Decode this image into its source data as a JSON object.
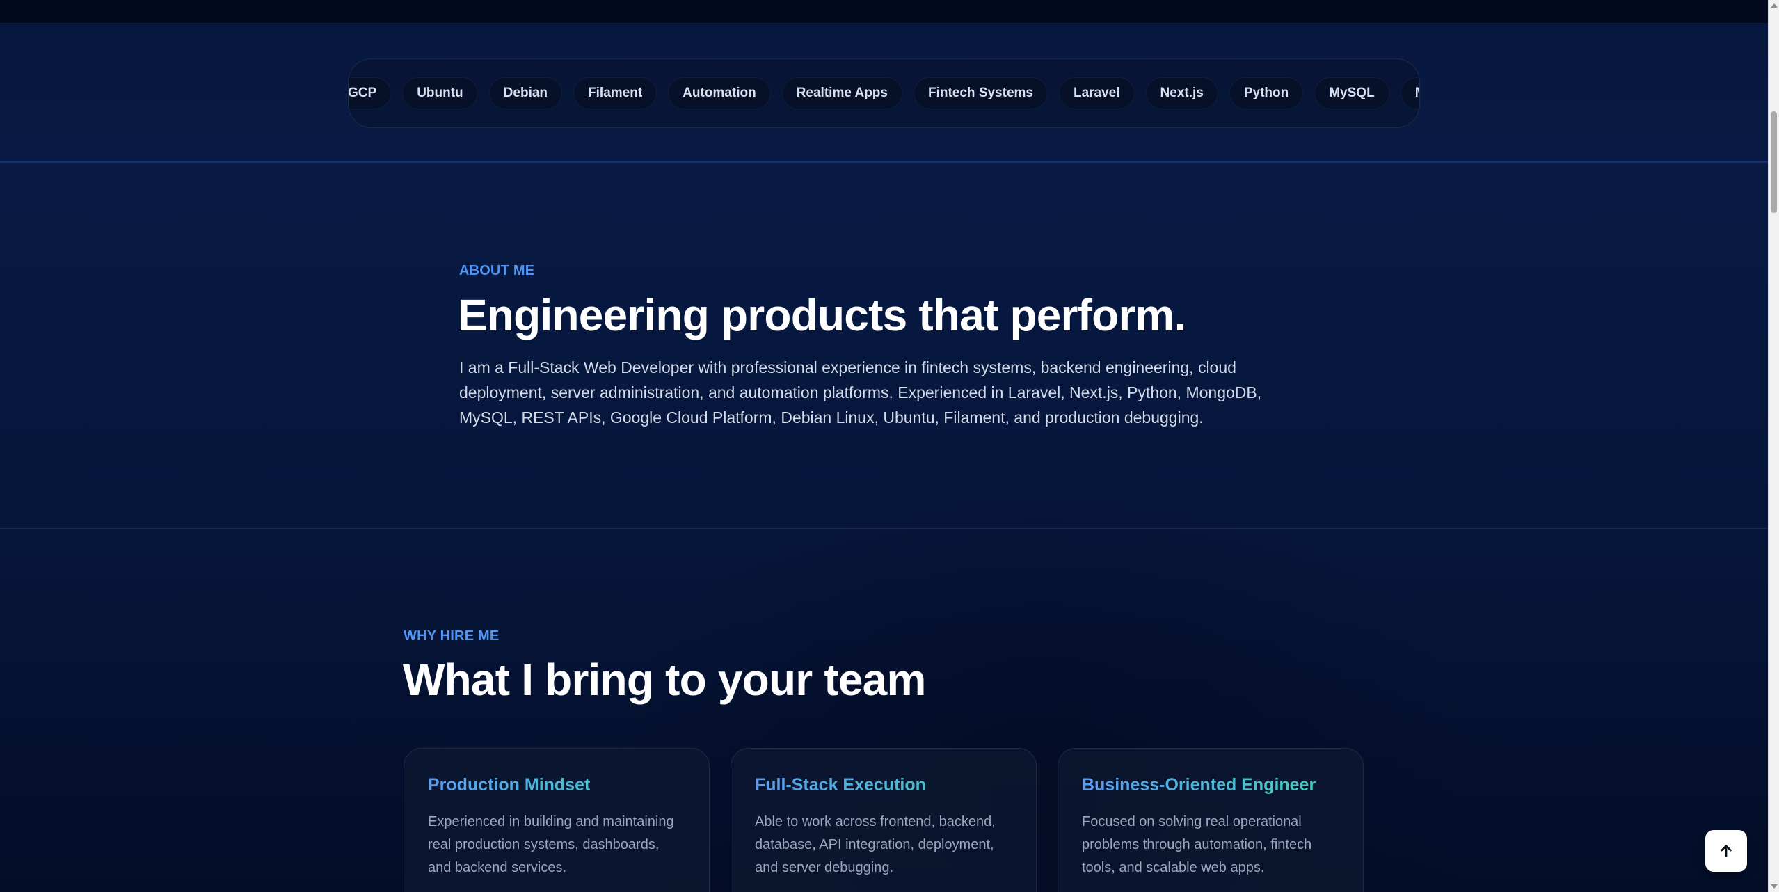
{
  "tech_marquee": {
    "chips": [
      "GCP",
      "Ubuntu",
      "Debian",
      "Filament",
      "Automation",
      "Realtime Apps",
      "Fintech Systems",
      "Laravel",
      "Next.js",
      "Python",
      "MySQL",
      "MongoDB"
    ]
  },
  "about": {
    "eyebrow": "ABOUT ME",
    "title": "Engineering products that perform.",
    "body": "I am a Full-Stack Web Developer with professional experience in fintech systems, backend engineering, cloud deployment, server administration, and automation platforms. Experienced in Laravel, Next.js, Python, MongoDB, MySQL, REST APIs, Google Cloud Platform, Debian Linux, Ubuntu, Filament, and production debugging."
  },
  "why": {
    "eyebrow": "WHY HIRE ME",
    "title": "What I bring to your team",
    "cards": [
      {
        "title": "Production Mindset",
        "body": "Experienced in building and maintaining real production systems, dashboards, and backend services."
      },
      {
        "title": "Full-Stack Execution",
        "body": "Able to work across frontend, backend, database, API integration, deployment, and server debugging."
      },
      {
        "title": "Business-Oriented Engineer",
        "body": "Focused on solving real operational problems through automation, fintech tools, and scalable web apps."
      }
    ]
  },
  "back_to_top": {
    "icon": "arrow-up-icon"
  },
  "colors": {
    "accent": "#4f95f5",
    "accent_teal": "#3fd3b8",
    "background": "#061230"
  }
}
